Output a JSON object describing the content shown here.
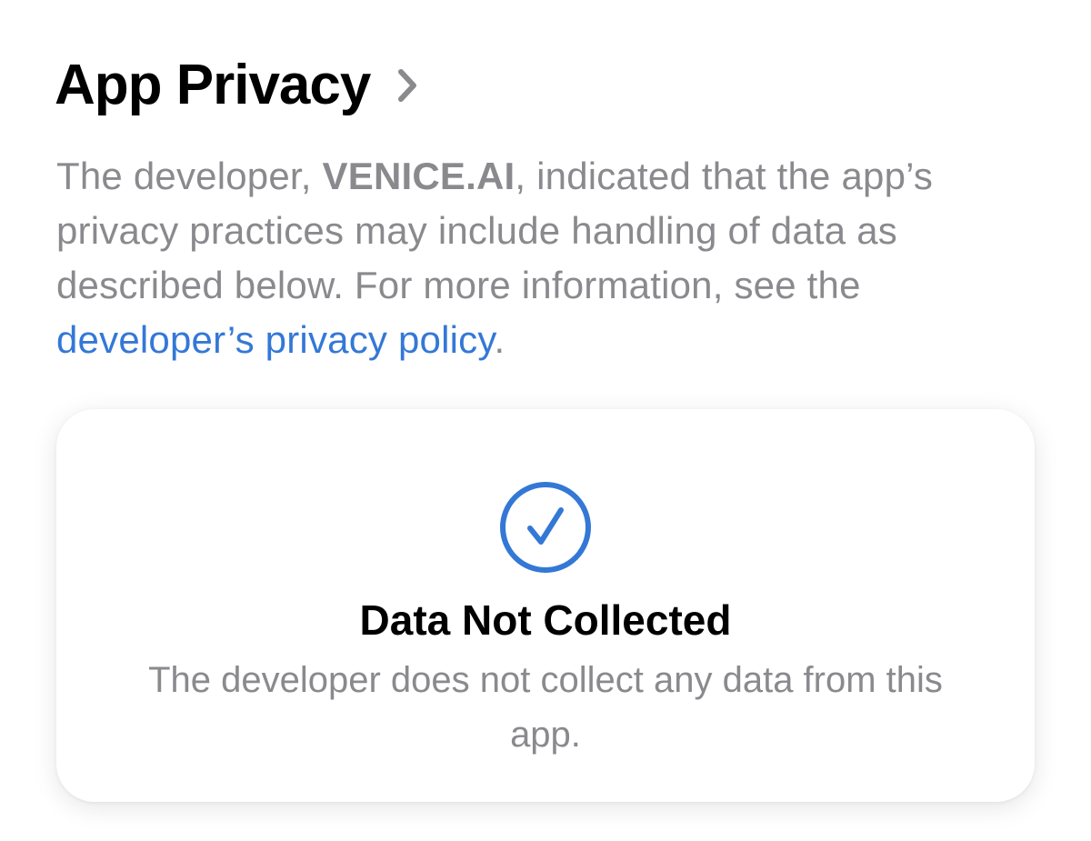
{
  "header": {
    "title": "App Privacy",
    "chevron_icon": "chevron-right-icon"
  },
  "description": {
    "prefix": "The developer, ",
    "developer_name": "VENICE.AI",
    "middle": ", indicated that the app’s privacy practices may include handling of data as described below. For more information, see the ",
    "link_text": "developer’s privacy policy",
    "suffix": "."
  },
  "card": {
    "icon": "checkmark-circle-icon",
    "title": "Data Not Collected",
    "description": "The developer does not collect any data from this app."
  },
  "colors": {
    "link": "#3478d6",
    "secondary_text": "#8a8a8e",
    "accent": "#3478d6"
  }
}
